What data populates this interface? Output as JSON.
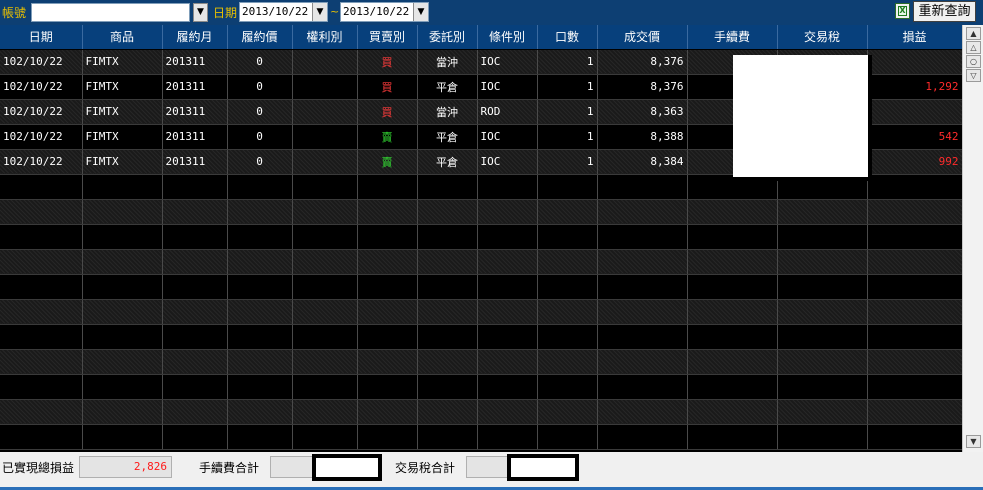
{
  "toolbar": {
    "account_label": "帳號",
    "account_value": "",
    "date_label": "日期",
    "date_from": "2013/10/22",
    "range_separator": "~",
    "date_to": "2013/10/22",
    "excel_icon": "excel-export-icon",
    "requery_label": "重新查詢"
  },
  "grid": {
    "columns": [
      "日期",
      "商品",
      "履約月",
      "履約價",
      "權利別",
      "買賣別",
      "委託別",
      "條件別",
      "口數",
      "成交價",
      "手續費",
      "交易稅",
      "損益"
    ],
    "rows": [
      {
        "date": "102/10/22",
        "product": "FIMTX",
        "month": "201311",
        "strike": "0",
        "right": "",
        "side": "買",
        "order_type": "當沖",
        "condition": "IOC",
        "qty": "1",
        "price": "8,376",
        "fee": "",
        "tax": "",
        "pl": ""
      },
      {
        "date": "102/10/22",
        "product": "FIMTX",
        "month": "201311",
        "strike": "0",
        "right": "",
        "side": "買",
        "order_type": "平倉",
        "condition": "IOC",
        "qty": "1",
        "price": "8,376",
        "fee": "",
        "tax": "",
        "pl": "1,292"
      },
      {
        "date": "102/10/22",
        "product": "FIMTX",
        "month": "201311",
        "strike": "0",
        "right": "",
        "side": "買",
        "order_type": "當沖",
        "condition": "ROD",
        "qty": "1",
        "price": "8,363",
        "fee": "",
        "tax": "",
        "pl": ""
      },
      {
        "date": "102/10/22",
        "product": "FIMTX",
        "month": "201311",
        "strike": "0",
        "right": "",
        "side": "賣",
        "order_type": "平倉",
        "condition": "IOC",
        "qty": "1",
        "price": "8,388",
        "fee": "",
        "tax": "",
        "pl": "542"
      },
      {
        "date": "102/10/22",
        "product": "FIMTX",
        "month": "201311",
        "strike": "0",
        "right": "",
        "side": "賣",
        "order_type": "平倉",
        "condition": "IOC",
        "qty": "1",
        "price": "8,384",
        "fee": "",
        "tax": "",
        "pl": "992"
      }
    ],
    "empty_row_count": 11
  },
  "footer": {
    "realized_pl_label": "已實現總損益",
    "realized_pl_value": "2,826",
    "fee_total_label": "手續費合計",
    "fee_total_value": "",
    "tax_total_label": "交易稅合計",
    "tax_total_value": ""
  },
  "colors": {
    "header_bg": "#07407c",
    "buy": "#ff3b3b",
    "sell": "#33e033",
    "profit_text": "#ff2b2b",
    "label_yellow": "#e8c000"
  }
}
